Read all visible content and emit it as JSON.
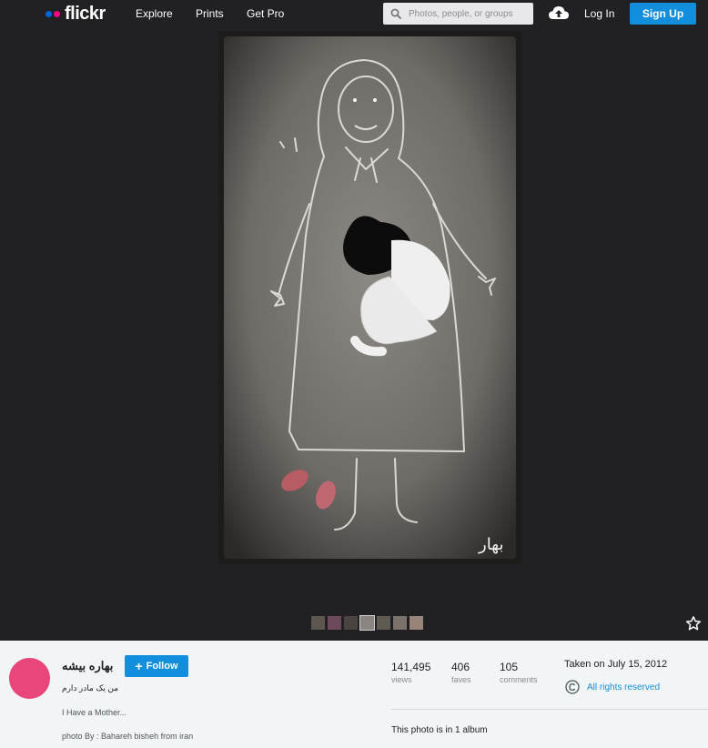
{
  "header": {
    "logo_text": "flickr",
    "nav": [
      {
        "label": "Explore"
      },
      {
        "label": "Prints"
      },
      {
        "label": "Get Pro"
      }
    ],
    "search_placeholder": "Photos, people, or groups",
    "login_label": "Log In",
    "signup_label": "Sign Up"
  },
  "photo": {
    "thumbnail_count": 7,
    "signature_text": "بهار"
  },
  "owner": {
    "name": "بهاره بیشه",
    "follow_label": "Follow",
    "subtitle": "من یک مادر دارم",
    "title": "I Have a Mother...",
    "description": "photo By : Bahareh bisheh from iran"
  },
  "stats": [
    {
      "value": "141,495",
      "label": "views"
    },
    {
      "value": "406",
      "label": "faves"
    },
    {
      "value": "105",
      "label": "comments"
    }
  ],
  "taken": "Taken on July 15, 2012",
  "rights": "All rights reserved",
  "album_text": "This photo is in 1 album",
  "colors": {
    "header_bg": "#212124",
    "accent": "#128fdc",
    "avatar": "#e9467a",
    "logo_blue": "#0063dc",
    "logo_pink": "#ff0084"
  }
}
